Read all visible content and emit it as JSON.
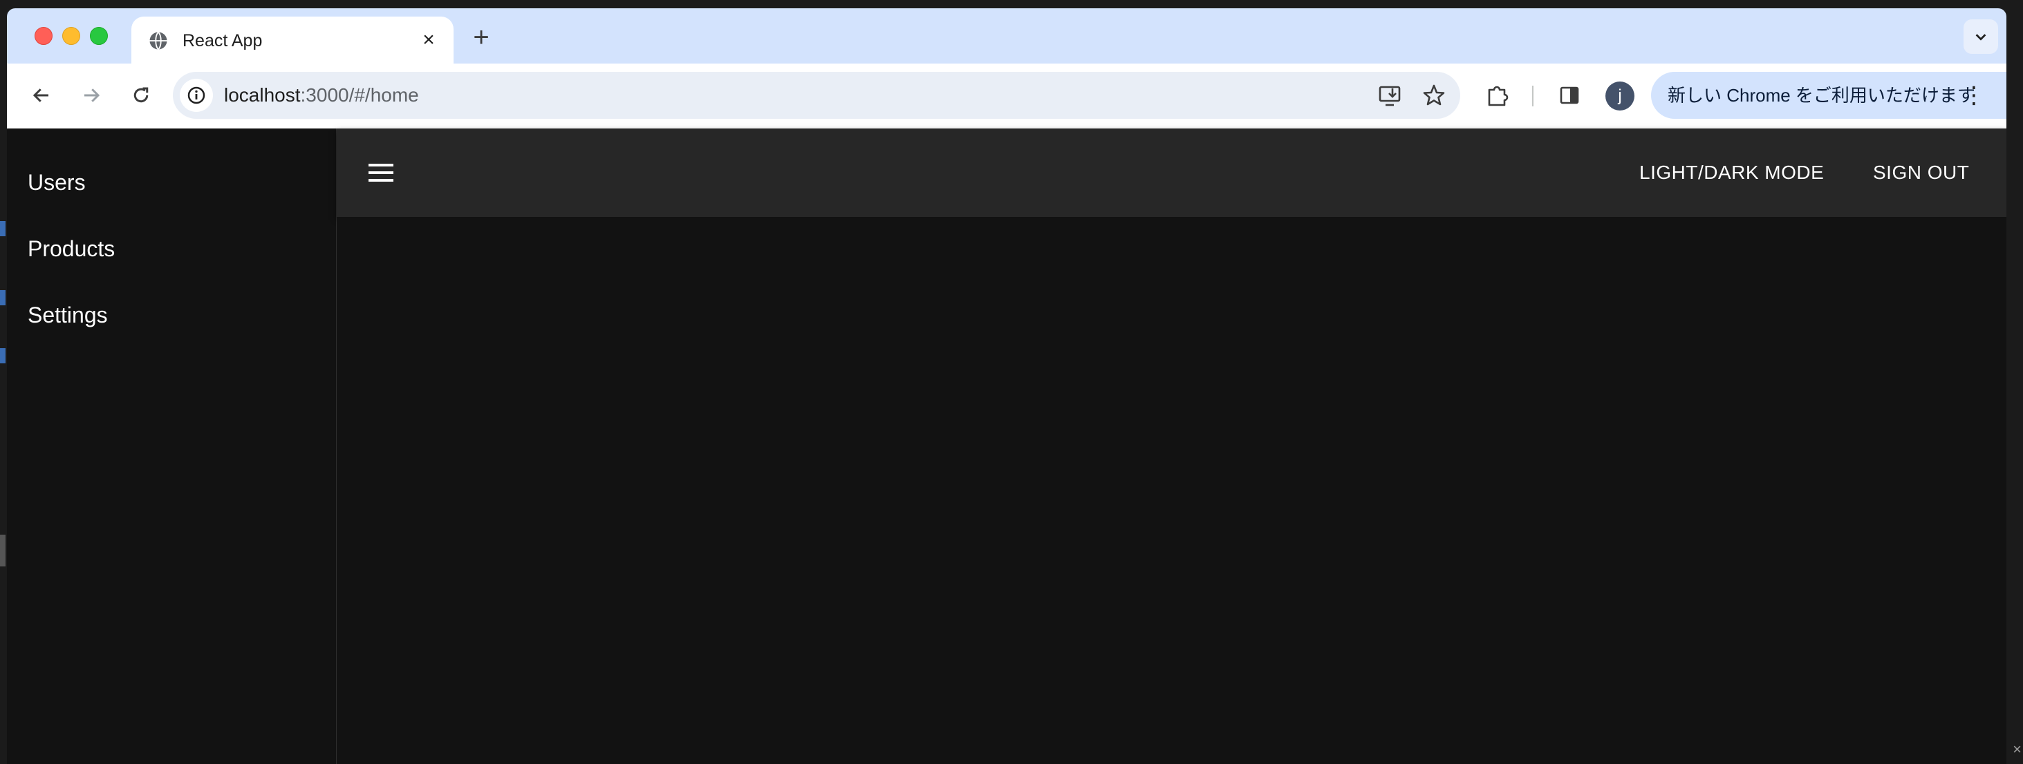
{
  "browser": {
    "tab": {
      "title": "React App"
    },
    "address_bar": {
      "host": "localhost",
      "path": ":3000/#/home"
    },
    "profile_initial": "j",
    "update_banner": "新しい Chrome をご利用いただけます",
    "icons": {
      "tab_favicon": "globe-icon",
      "tab_close": "close-icon",
      "new_tab": "plus-icon",
      "tab_search": "chevron-down-icon",
      "back": "arrow-left-icon",
      "forward": "arrow-right-icon",
      "reload": "reload-icon",
      "site_info": "info-icon",
      "install": "install-app-icon",
      "bookmark": "star-icon",
      "extensions": "puzzle-icon",
      "side_panel": "side-panel-icon",
      "more": "kebab-menu-icon"
    }
  },
  "app": {
    "sidebar": {
      "items": [
        {
          "label": "Users"
        },
        {
          "label": "Products"
        },
        {
          "label": "Settings"
        }
      ]
    },
    "appbar": {
      "menu_icon": "hamburger-icon",
      "theme_toggle_label": "LIGHT/DARK MODE",
      "sign_out_label": "SIGN OUT"
    }
  },
  "colors": {
    "tabstrip": "#d3e3fd",
    "page_background": "#121212",
    "appbar_background": "#272727",
    "text_on_dark": "#ffffff"
  }
}
